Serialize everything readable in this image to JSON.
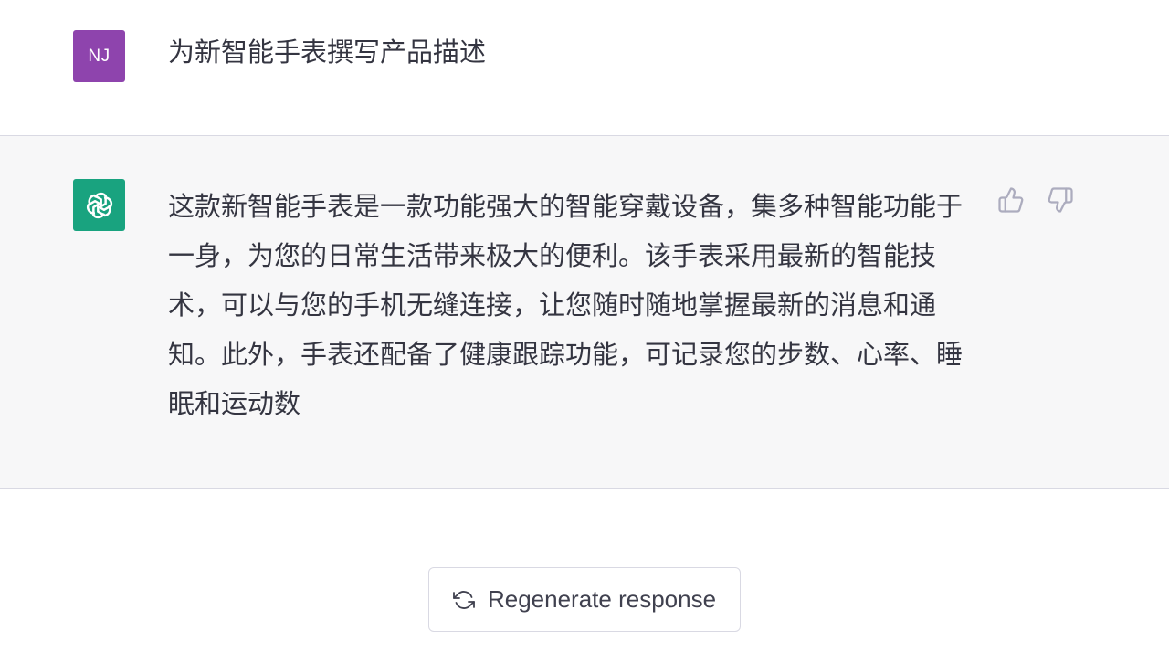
{
  "user_message": {
    "avatar_initials": "NJ",
    "avatar_color": "#8e44ad",
    "text": "为新智能手表撰写产品描述"
  },
  "assistant_message": {
    "avatar_icon": "openai-logo-icon",
    "avatar_color": "#19a37f",
    "text": "这款新智能手表是一款功能强大的智能穿戴设备，集多种智能功能于一身，为您的日常生活带来极大的便利。该手表采用最新的智能技术，可以与您的手机无缝连接，让您随时随地掌握最新的消息和通知。此外，手表还配备了健康跟踪功能，可记录您的步数、心率、睡眠和运动数",
    "feedback": {
      "up_icon": "thumbs-up-icon",
      "down_icon": "thumbs-down-icon"
    }
  },
  "actions": {
    "regenerate_label": "Regenerate response",
    "regenerate_icon": "refresh-icon"
  }
}
